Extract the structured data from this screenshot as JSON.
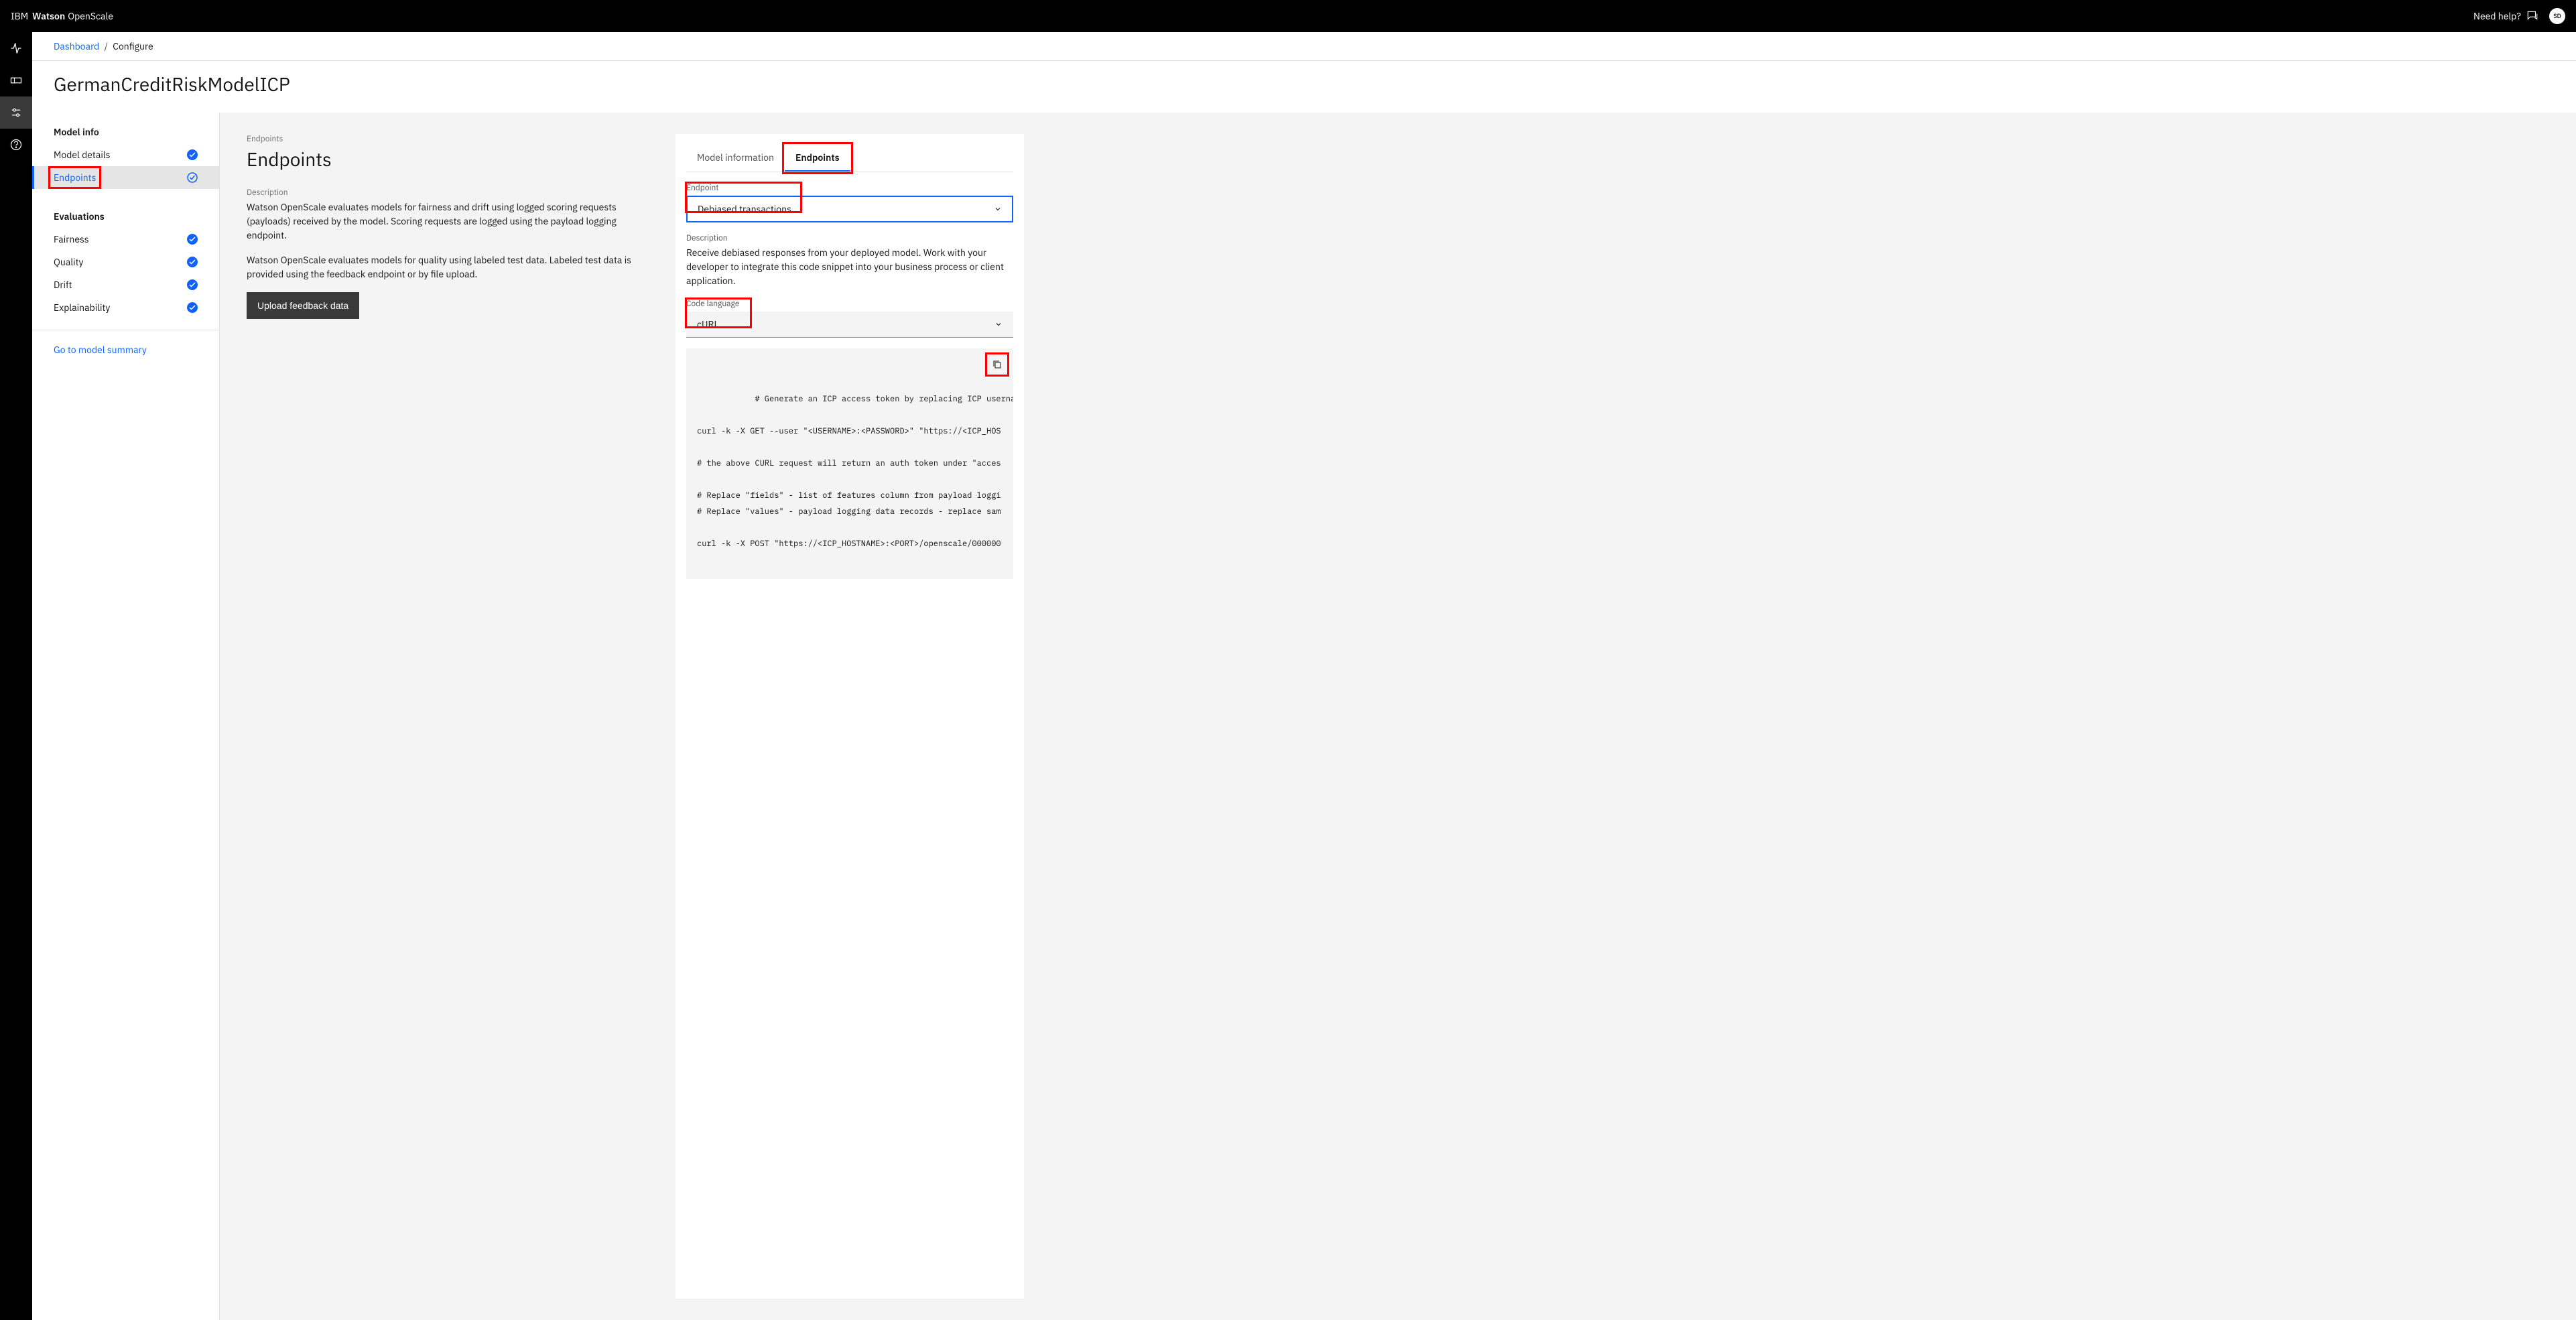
{
  "header": {
    "brand_ibm": "IBM",
    "brand_watson": "Watson",
    "brand_openscale": "OpenScale",
    "need_help": "Need help?",
    "avatar_initials": "SD"
  },
  "breadcrumb": {
    "dashboard": "Dashboard",
    "configure": "Configure"
  },
  "page_title": "GermanCreditRiskModelICP",
  "sidebar": {
    "model_info_heading": "Model info",
    "model_details": "Model details",
    "endpoints": "Endpoints",
    "evaluations_heading": "Evaluations",
    "fairness": "Fairness",
    "quality": "Quality",
    "drift": "Drift",
    "explainability": "Explainability",
    "go_to_summary": "Go to model summary"
  },
  "main": {
    "section_label": "Endpoints",
    "title": "Endpoints",
    "description_label": "Description",
    "description1": "Watson OpenScale evaluates models for fairness and drift using logged scoring requests (payloads) received by the model. Scoring requests are logged using the payload logging endpoint.",
    "description2": "Watson OpenScale evaluates models for quality using labeled test data. Labeled test data is provided using the feedback endpoint or by file upload.",
    "upload_button": "Upload feedback data"
  },
  "right_panel": {
    "tabs": {
      "model_info": "Model information",
      "endpoints": "Endpoints"
    },
    "endpoint_label": "Endpoint",
    "endpoint_value": "Debiased transactions",
    "desc_label": "Description",
    "desc_text": "Receive debiased responses from your deployed model. Work with your developer to integrate this code snippet into your business process or client application.",
    "code_lang_label": "Code language",
    "code_lang_value": "cURL",
    "code": "# Generate an ICP access token by replacing ICP username as \n\ncurl -k -X GET --user \"<USERNAME>:<PASSWORD>\" \"https://<ICP_HOS\n\n# the above CURL request will return an auth token under \"acces\n\n# Replace \"fields\" - list of features column from payload loggi\n# Replace \"values\" - payload logging data records - replace sam\n\ncurl -k -X POST \"https://<ICP_HOSTNAME>:<PORT>/openscale/000000"
  }
}
